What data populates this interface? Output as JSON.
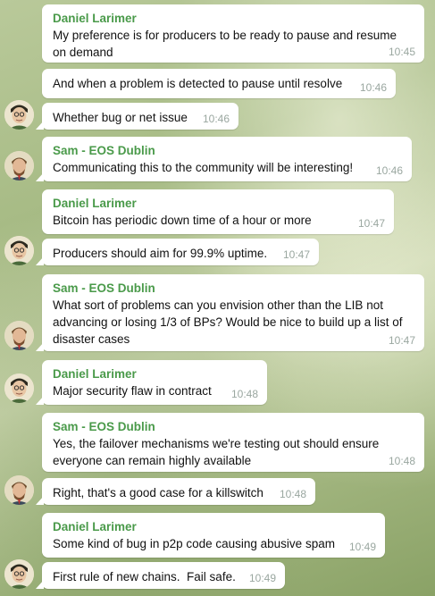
{
  "messages": [
    {
      "sender": "Daniel Larimer",
      "text": "My preference is for producers to be ready to pause and resume on demand",
      "time": "10:45"
    },
    {
      "sender": "",
      "text": "And when a problem is detected to pause until resolve",
      "time": "10:46"
    },
    {
      "sender": "",
      "text": "Whether bug or net issue",
      "time": "10:46"
    },
    {
      "sender": "Sam - EOS Dublin",
      "text": "Communicating this to the community will be interesting!",
      "time": "10:46"
    },
    {
      "sender": "Daniel Larimer",
      "text": "Bitcoin has periodic down time of a hour or more",
      "time": "10:47"
    },
    {
      "sender": "",
      "text": "Producers should aim for 99.9% uptime.",
      "time": "10:47"
    },
    {
      "sender": "Sam - EOS Dublin",
      "text": "What sort of problems can you envision other than the LIB not advancing or losing 1/3 of BPs? Would be nice to build up a list of disaster cases",
      "time": "10:47"
    },
    {
      "sender": "Daniel Larimer",
      "text": "Major security flaw in contract",
      "time": "10:48"
    },
    {
      "sender": "Sam - EOS Dublin",
      "text": "Yes, the failover mechanisms we're testing out should ensure everyone can remain highly available",
      "time": "10:48"
    },
    {
      "sender": "",
      "text": "Right, that's a good case for a killswitch",
      "time": "10:48"
    },
    {
      "sender": "Daniel Larimer",
      "text": "Some kind of bug in p2p code causing abusive spam",
      "time": "10:49"
    },
    {
      "sender": "",
      "text": "First rule of new chains.  Fail safe.",
      "time": "10:49"
    }
  ],
  "colors": {
    "sender_name": "#4a9a4a",
    "timestamp": "#9aa7a0",
    "bubble": "#ffffff"
  }
}
